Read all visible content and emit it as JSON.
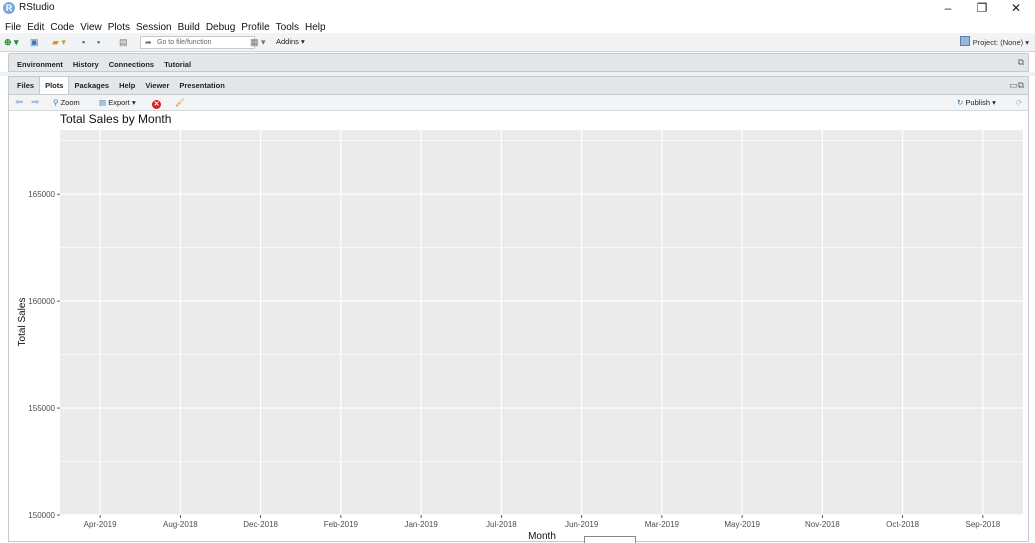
{
  "window": {
    "app_name": "RStudio"
  },
  "menu": [
    "File",
    "Edit",
    "Code",
    "View",
    "Plots",
    "Session",
    "Build",
    "Debug",
    "Profile",
    "Tools",
    "Help"
  ],
  "toolbar": {
    "goto_placeholder": "Go to file/function",
    "addins_label": "Addins",
    "project_label": "Project: (None)"
  },
  "upper_pane": {
    "tabs": [
      "Environment",
      "History",
      "Connections",
      "Tutorial"
    ]
  },
  "lower_pane": {
    "tabs": [
      "Files",
      "Plots",
      "Packages",
      "Help",
      "Viewer",
      "Presentation"
    ],
    "active_tab": "Plots",
    "toolbar": {
      "zoom_label": "Zoom",
      "export_label": "Export",
      "publish_label": "Publish"
    }
  },
  "chart_data": {
    "type": "bar",
    "title": "Total Sales by Month",
    "xlabel": "Month",
    "ylabel": "Total Sales",
    "categories": [
      "Apr-2019",
      "Aug-2018",
      "Dec-2018",
      "Feb-2019",
      "Jan-2019",
      "Jul-2018",
      "Jun-2019",
      "Mar-2019",
      "May-2019",
      "Nov-2018",
      "Oct-2018",
      "Sep-2018"
    ],
    "values": [],
    "ylim": [
      150000,
      168000
    ],
    "yticks": [
      150000,
      155000,
      160000,
      165000
    ],
    "ytick_labels": [
      "150000",
      "155000",
      "160000",
      "165000"
    ],
    "grid": true,
    "background": "#ebebeb",
    "gridline_color": "#ffffff"
  }
}
